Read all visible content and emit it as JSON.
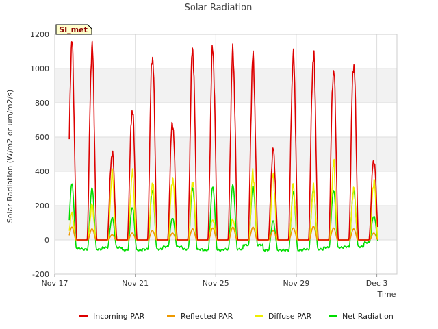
{
  "chart_data": {
    "type": "line",
    "title": "Solar Radiation",
    "xlabel": "Time",
    "ylabel": "Solar Radiation (W/m2 or um/m2/s)",
    "station_label": "SI_met",
    "xlim": [
      0,
      17
    ],
    "ylim": [
      -200,
      1200
    ],
    "y_ticks": [
      -200,
      0,
      200,
      400,
      600,
      800,
      1000,
      1200
    ],
    "x_ticks": [
      {
        "day": 0,
        "label": "Nov 17"
      },
      {
        "day": 4,
        "label": "Nov 21"
      },
      {
        "day": 8,
        "label": "Nov 25"
      },
      {
        "day": 12,
        "label": "Nov 29"
      },
      {
        "day": 16,
        "label": "Dec 3"
      }
    ],
    "grid": true,
    "banded_background": true,
    "legend_position": "bottom",
    "x_unit": "days since Nov 17",
    "daily_peaks": [
      {
        "day": 0.85,
        "incoming": 1140,
        "reflected": 75,
        "diffuse": 150,
        "net_peak": 325,
        "net_night": -50
      },
      {
        "day": 1.85,
        "incoming": 1120,
        "reflected": 65,
        "diffuse": 200,
        "net_peak": 300,
        "net_night": -55
      },
      {
        "day": 2.85,
        "incoming": 510,
        "reflected": 30,
        "diffuse": 380,
        "net_peak": 130,
        "net_night": -45
      },
      {
        "day": 3.85,
        "incoming": 765,
        "reflected": 40,
        "diffuse": 390,
        "net_peak": 190,
        "net_night": -60
      },
      {
        "day": 4.85,
        "incoming": 1085,
        "reflected": 55,
        "diffuse": 330,
        "net_peak": 290,
        "net_night": -55
      },
      {
        "day": 5.85,
        "incoming": 690,
        "reflected": 40,
        "diffuse": 360,
        "net_peak": 130,
        "net_night": -40
      },
      {
        "day": 6.85,
        "incoming": 1115,
        "reflected": 65,
        "diffuse": 350,
        "net_peak": 305,
        "net_night": -55
      },
      {
        "day": 7.85,
        "incoming": 1110,
        "reflected": 70,
        "diffuse": 120,
        "net_peak": 310,
        "net_night": -60
      },
      {
        "day": 8.85,
        "incoming": 1085,
        "reflected": 75,
        "diffuse": 120,
        "net_peak": 320,
        "net_night": -55
      },
      {
        "day": 9.85,
        "incoming": 1055,
        "reflected": 75,
        "diffuse": 390,
        "net_peak": 310,
        "net_night": -30
      },
      {
        "day": 10.85,
        "incoming": 520,
        "reflected": 55,
        "diffuse": 370,
        "net_peak": 110,
        "net_night": -60
      },
      {
        "day": 11.85,
        "incoming": 1065,
        "reflected": 70,
        "diffuse": 305,
        "net_peak": 280,
        "net_night": -60
      },
      {
        "day": 12.85,
        "incoming": 1080,
        "reflected": 80,
        "diffuse": 300,
        "net_peak": 300,
        "net_night": -55
      },
      {
        "day": 13.85,
        "incoming": 1000,
        "reflected": 70,
        "diffuse": 440,
        "net_peak": 290,
        "net_night": -45
      },
      {
        "day": 14.85,
        "incoming": 1040,
        "reflected": 65,
        "diffuse": 300,
        "net_peak": 290,
        "net_night": -40
      },
      {
        "day": 15.85,
        "incoming": 470,
        "reflected": 40,
        "diffuse": 345,
        "net_peak": 140,
        "net_night": -15
      }
    ],
    "series": [
      {
        "name": "Incoming PAR",
        "color": "#dd0000",
        "key": "incoming"
      },
      {
        "name": "Reflected PAR",
        "color": "#ee9900",
        "key": "reflected"
      },
      {
        "name": "Diffuse PAR",
        "color": "#eeee00",
        "key": "diffuse"
      },
      {
        "name": "Net Radiation",
        "color": "#00dd00",
        "key": "net"
      }
    ]
  }
}
